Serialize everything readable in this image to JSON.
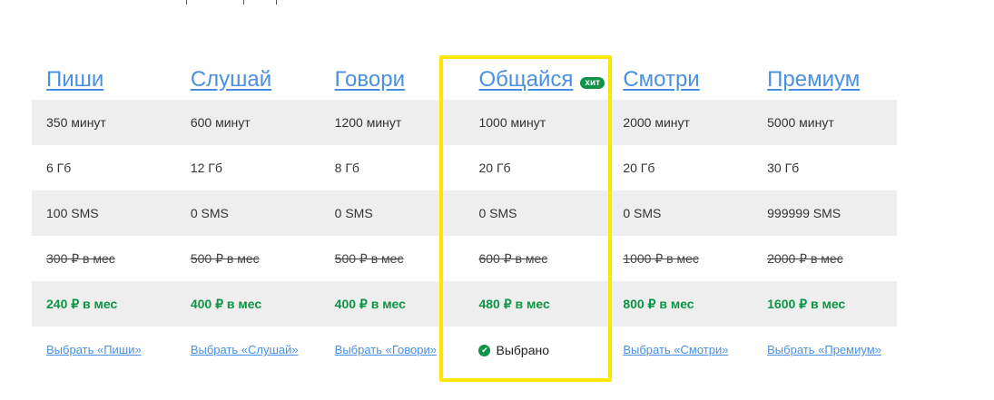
{
  "plans": [
    {
      "name": "Пиши",
      "minutes": "350 минут",
      "data": "6 Гб",
      "sms": "100 SMS",
      "old_price": "300 ₽ в мес",
      "price": "240 ₽  в мес",
      "action": "Выбрать «Пиши»"
    },
    {
      "name": "Слушай",
      "minutes": "600 минут",
      "data": "12 Гб",
      "sms": "0 SMS",
      "old_price": "500 ₽ в мес",
      "price": "400 ₽  в мес",
      "action": "Выбрать «Слушай»"
    },
    {
      "name": "Говори",
      "minutes": "1200 минут",
      "data": "8 Гб",
      "sms": "0 SMS",
      "old_price": "500 ₽ в мес",
      "price": "400 ₽  в мес",
      "action": "Выбрать «Говори»"
    },
    {
      "name": "Общайся",
      "badge": "хит",
      "minutes": "1000 минут",
      "data": "20 Гб",
      "sms": "0 SMS",
      "old_price": "600 ₽ в мес",
      "price": "480 ₽  в мес",
      "action": "Выбрано"
    },
    {
      "name": "Смотри",
      "minutes": "2000 минут",
      "data": "20 Гб",
      "sms": "0 SMS",
      "old_price": "1000 ₽ в мес",
      "price": "800 ₽  в мес",
      "action": "Выбрать «Смотри»"
    },
    {
      "name": "Премиум",
      "minutes": "5000 минут",
      "data": "30 Гб",
      "sms": "999999 SMS",
      "old_price": "2000 ₽ в мес",
      "price": "1600 ₽  в мес",
      "action": "Выбрать «Премиум»"
    }
  ],
  "colors": {
    "highlight": "#ffe600",
    "accent": "#0d9447",
    "link": "#4a90e2"
  }
}
